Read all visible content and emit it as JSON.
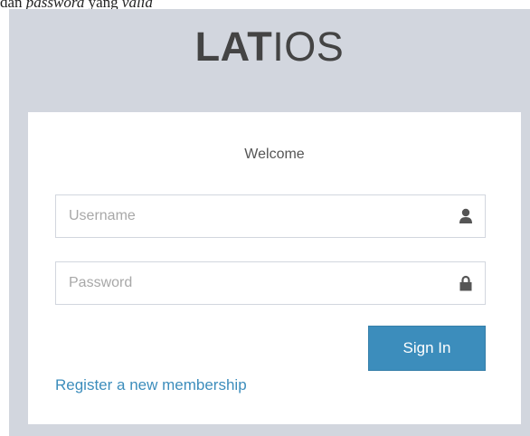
{
  "caption": {
    "plain": "dan ",
    "italic1": "password",
    "middle": " yang ",
    "italic2": "valid"
  },
  "logo": {
    "bold": "LAT",
    "normal": "IOS"
  },
  "login": {
    "welcome": "Welcome",
    "username_placeholder": "Username",
    "username_value": "",
    "password_placeholder": "Password",
    "password_value": "",
    "signin_label": "Sign In",
    "register_label": "Register a new membership"
  },
  "icons": {
    "username": "user-icon",
    "password": "lock-icon"
  },
  "colors": {
    "page_background": "#d2d6de",
    "primary": "#3c8dbc",
    "logo_text": "#444444"
  }
}
